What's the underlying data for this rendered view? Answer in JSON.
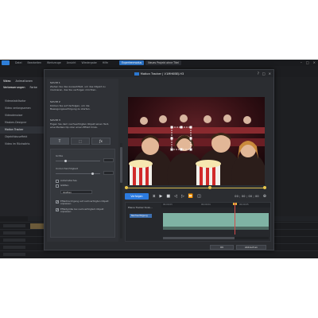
{
  "menubar": {
    "items": [
      "Datei",
      "Bearbeiten",
      "Werkzeuge",
      "Ansicht",
      "Wiedergabe",
      "Hilfe"
    ],
    "center_tabs": [
      "Expertenmodus",
      "Neues Projekt ohne Titel"
    ]
  },
  "left_panel": {
    "tabs": [
      "Video",
      "Animationen"
    ],
    "subtabs": [
      "Verbesserungen",
      "Farbe"
    ],
    "items": [
      "Videostabilisator",
      "Video verlangsamen",
      "Videodenoiser",
      "Masken-Designer",
      "Motion Tracker",
      "Objektfokuseffekt",
      "Video im Rückwärts"
    ],
    "selected_index": 4
  },
  "dialog": {
    "title": "Motion Tracker | V1MH0BEJ.H3",
    "steps": [
      {
        "title": "Schritt 1",
        "text": "Ziehen Sie das Auswahlfeld, um das Objekt zu markieren, das Sie verfolgen möchten."
      },
      {
        "title": "Schritt 2",
        "text": "Klicken Sie auf Verfolgen, um die Bewegungsverfolgung zu starten."
      },
      {
        "title": "Schritt 3",
        "text": "Fügen Sie dem nachverfolgten Objekt einen Text, eine Medienclip oder einen Effekt hinzu."
      }
    ],
    "shape_buttons": [
      "T",
      "⬚",
      "ƒx"
    ],
    "properties": {
      "size_label": "Größe",
      "opacity_label": "Undurchsichtigkeit",
      "size_value": 0.2,
      "opacity_value": 0.8,
      "auto_fade_label": "Automatisches",
      "blur_label": "Glätten",
      "blend_select": "Glatten",
      "check1_label": "Effektdurchgang auf nachverfolgten Objekt anpassen",
      "check2_label": "Effektgröße bei nachverfolgtem Objekt anpassen"
    },
    "track_button": "Verfolgen",
    "timecode": "00 ; 00 ; 00 ; 00",
    "tracker": {
      "header": "Ebene Tracker hinzu...",
      "object_label": "Nachverfolgung",
      "ruler_marks": [
        "00;00;03",
        "00;00;04",
        "00;00;05"
      ]
    },
    "ok_label": "OK",
    "cancel_label": "Abbrechen"
  },
  "right_time": "00;00;10"
}
